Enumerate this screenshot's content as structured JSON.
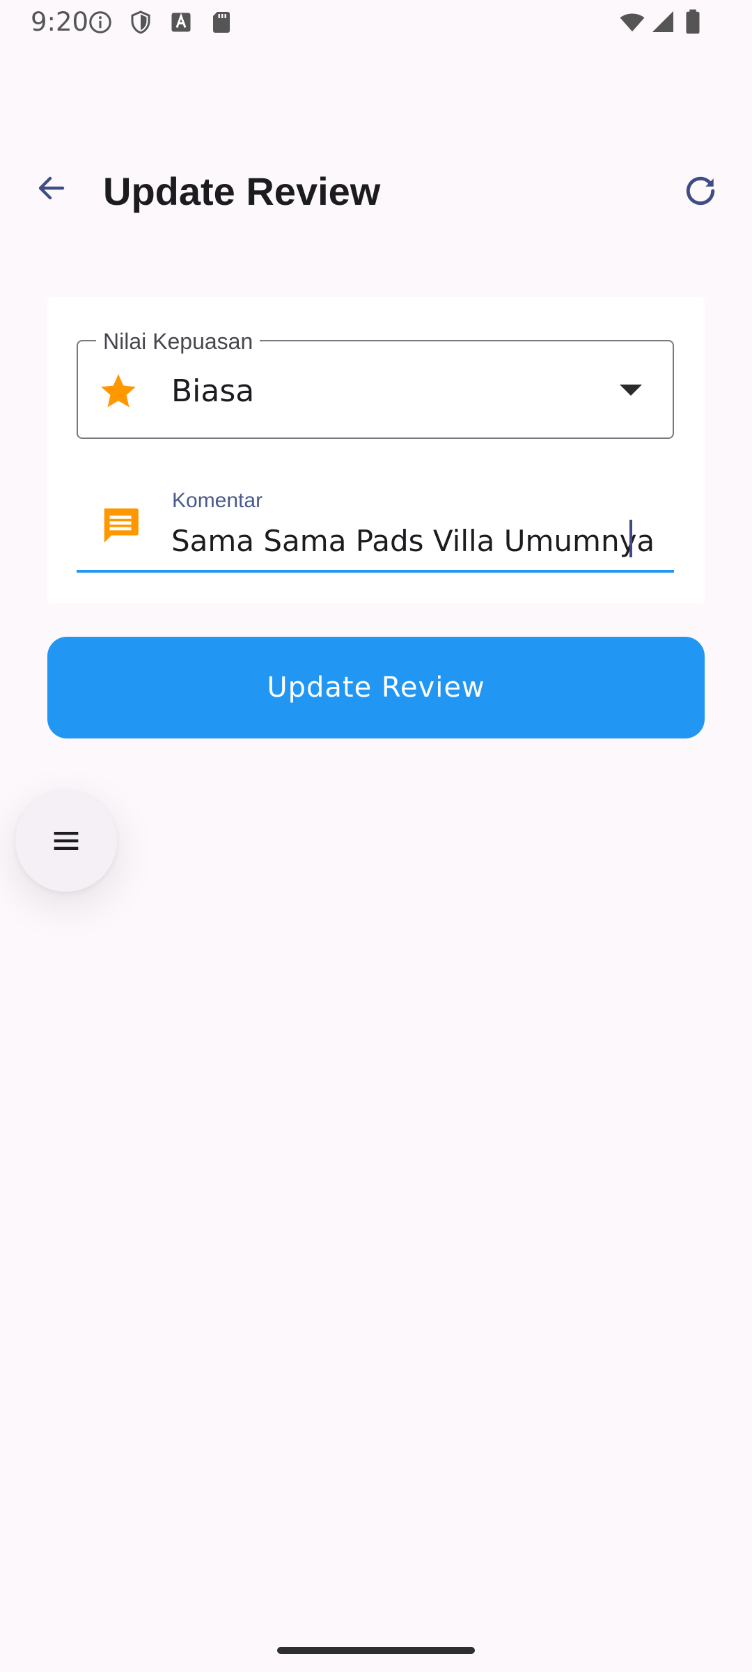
{
  "status_bar": {
    "time": "9:20",
    "left_icons": [
      "info-icon",
      "shield-icon",
      "font-a-icon",
      "sd-card-icon"
    ],
    "right_icons": [
      "wifi-icon",
      "signal-icon",
      "battery-icon"
    ]
  },
  "app_bar": {
    "title": "Update Review",
    "back_icon": "arrow-back-icon",
    "refresh_icon": "refresh-icon"
  },
  "form": {
    "rating": {
      "label": "Nilai Kepuasan",
      "value": "Biasa",
      "icon": "star-icon",
      "icon_color": "#ff9800"
    },
    "comment": {
      "label": "Komentar",
      "value": "Sama Sama Pads Villa Umumnya",
      "icon": "comment-icon",
      "icon_color": "#ff9800"
    },
    "submit_label": "Update Review"
  },
  "fab": {
    "icon": "menu-icon"
  },
  "colors": {
    "primary": "#2196f3",
    "accent": "#ff9800",
    "background": "#fcf8fc"
  }
}
